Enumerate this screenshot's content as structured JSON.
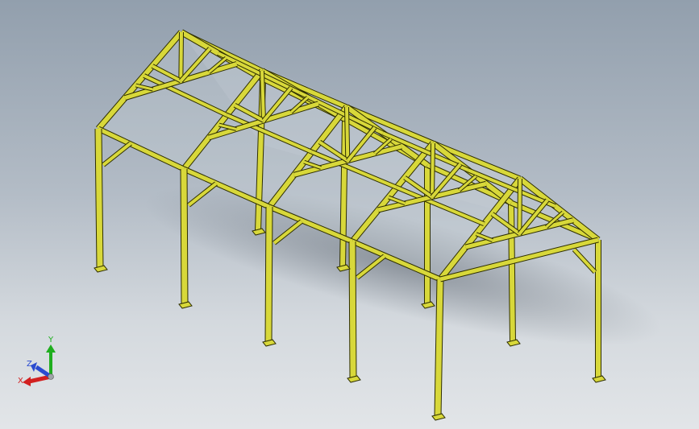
{
  "viewport": {
    "model": "steel-frame-shed",
    "member_color": "#d8d83a",
    "member_edge_color": "#2e2e00"
  },
  "triad": {
    "x_label": "X",
    "y_label": "Y",
    "z_label": "Z",
    "x_color": "#d22020",
    "y_color": "#1fae1f",
    "z_color": "#2a4bd0"
  }
}
